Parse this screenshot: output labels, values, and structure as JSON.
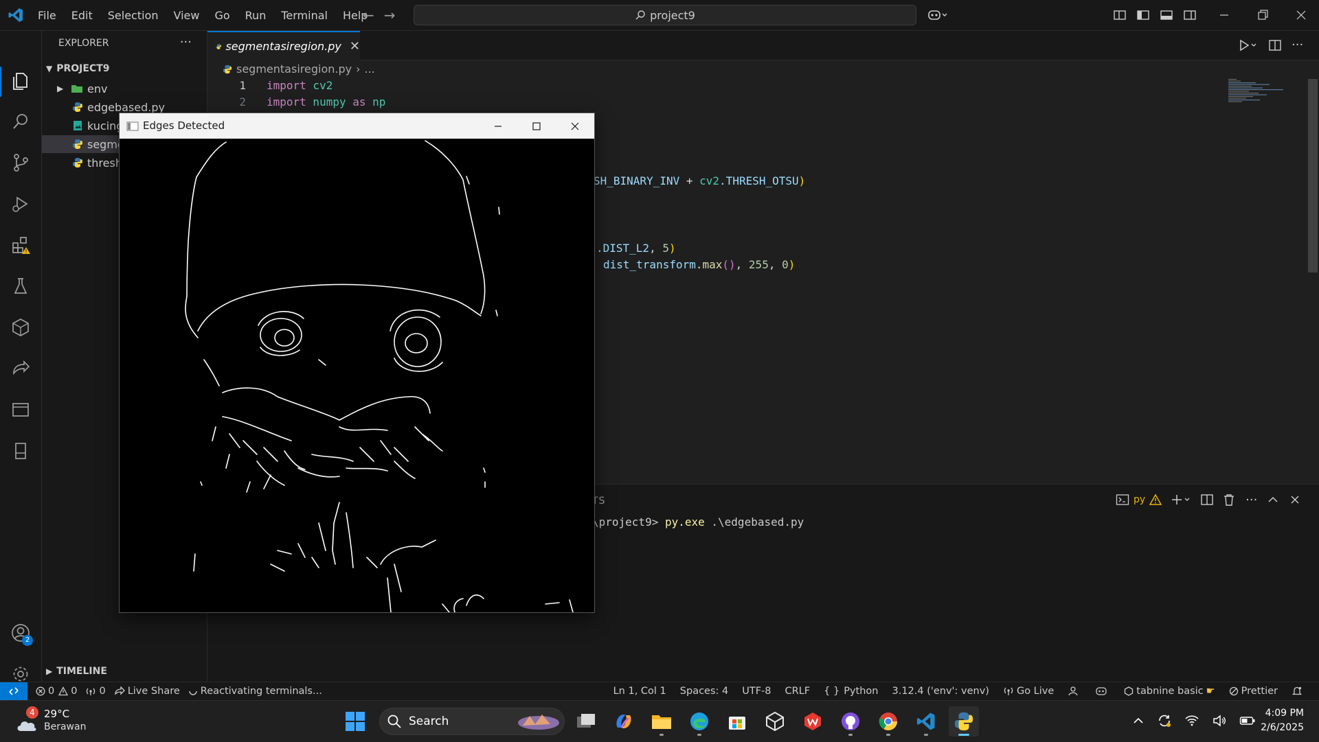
{
  "titlebar": {
    "menu": [
      "File",
      "Edit",
      "Selection",
      "View",
      "Go",
      "Run",
      "Terminal",
      "Help"
    ],
    "search": "project9"
  },
  "sidebar": {
    "header": "EXPLORER",
    "project": "PROJECT9",
    "items": [
      {
        "label": "env",
        "kind": "folder"
      },
      {
        "label": "edgebased.py",
        "kind": "python"
      },
      {
        "label": "kucing",
        "kind": "image"
      },
      {
        "label": "segme",
        "kind": "python"
      },
      {
        "label": "thresh",
        "kind": "python"
      }
    ],
    "timeline": "TIMELINE",
    "accounts_badge": "2"
  },
  "editor": {
    "tab_label": "segmentasiregion.py",
    "breadcrumb_file": "segmentasiregion.py",
    "breadcrumb_rest": "...",
    "lines": [
      {
        "n": "1",
        "a": "import",
        "b": " cv2"
      },
      {
        "n": "2",
        "a": "import",
        "b": " numpy",
        "c": " as",
        "d": " np"
      }
    ],
    "fragments": {
      "f1a": "SH_BINARY_INV",
      "f1b": " + ",
      "f1c": "cv2",
      "f1d": ".THRESH_OTSU",
      "f1e": ")",
      "f2a": ".DIST_L2",
      "f2b": ", ",
      "f2c": "5",
      "f2d": ")",
      "f3a": "dist_transform",
      "f3b": ".max",
      "f3c": "()",
      "f3d": ", ",
      "f3e": "255",
      "f3f": ", ",
      "f3g": "0",
      "f3h": ")"
    }
  },
  "panel": {
    "tab": "TS",
    "terminal_path": "\\project9> ",
    "terminal_cmd": "py.exe",
    "terminal_arg": " .\\edgebased.py",
    "shell_label": "py"
  },
  "cv_window": {
    "title": "Edges Detected"
  },
  "statusbar": {
    "errors": "0",
    "warnings": "0",
    "ports": "0",
    "live_share": "Live Share",
    "reactivating": "Reactivating terminals...",
    "position": "Ln 1, Col 1",
    "spaces": "Spaces: 4",
    "encoding": "UTF-8",
    "eol": "CRLF",
    "language": "Python",
    "interpreter": "3.12.4 ('env': venv)",
    "go_live": "Go Live",
    "tabnine": "tabnine basic",
    "prettier": "Prettier"
  },
  "taskbar": {
    "weather_temp": "29°C",
    "weather_desc": "Berawan",
    "weather_badge": "4",
    "search": "Search",
    "time": "4:09 PM",
    "date": "2/6/2025"
  },
  "colors": {
    "accent": "#0078d4",
    "keyword": "#c586c0",
    "module": "#4ec9b0"
  }
}
